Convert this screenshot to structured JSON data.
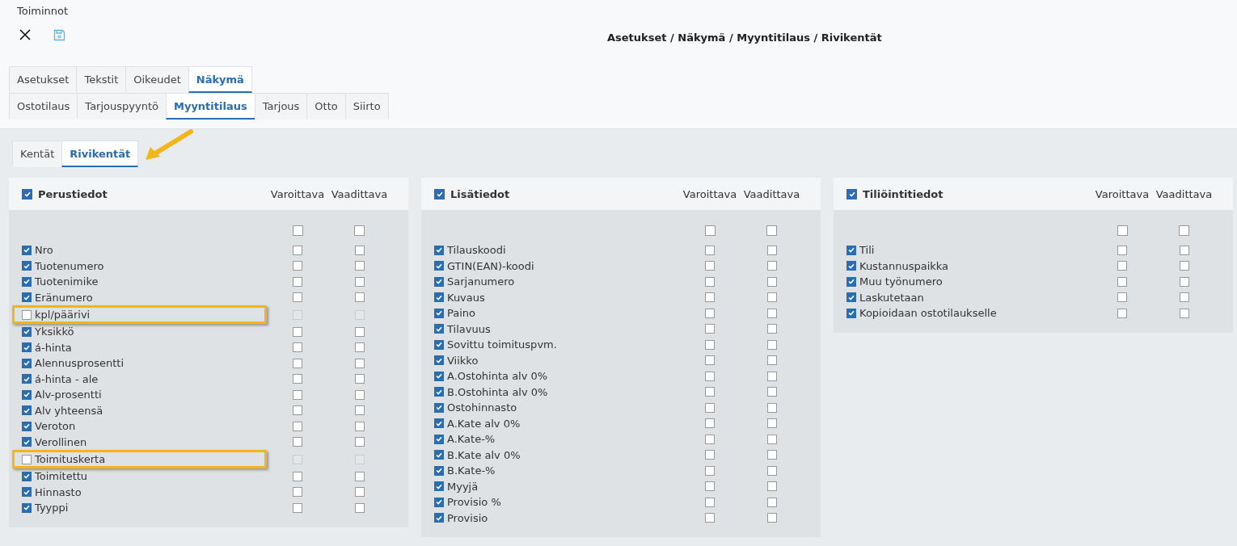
{
  "toolbar": {
    "title": "Toiminnot",
    "breadcrumb": "Asetukset / Näkymä / Myyntitilaus / Rivikentät"
  },
  "tabs": [
    {
      "label": "Asetukset",
      "selected": false
    },
    {
      "label": "Tekstit",
      "selected": false
    },
    {
      "label": "Oikeudet",
      "selected": false
    },
    {
      "label": "Näkymä",
      "selected": true
    }
  ],
  "subtabs": [
    {
      "label": "Ostotilaus",
      "selected": false
    },
    {
      "label": "Tarjouspyyntö",
      "selected": false
    },
    {
      "label": "Myyntitilaus",
      "selected": true
    },
    {
      "label": "Tarjous",
      "selected": false
    },
    {
      "label": "Otto",
      "selected": false
    },
    {
      "label": "Siirto",
      "selected": false
    }
  ],
  "section_tabs": [
    {
      "label": "Kentät",
      "selected": false
    },
    {
      "label": "Rivikentät",
      "selected": true
    }
  ],
  "panels": [
    {
      "title": "Perustiedot",
      "checked": true,
      "columns": [
        "Varoittava",
        "Vaadittava"
      ],
      "all_warning": false,
      "all_required": false,
      "fields": [
        {
          "label": "Nro",
          "checked": true,
          "warning": false,
          "required": false,
          "highlighted": false
        },
        {
          "label": "Tuotenumero",
          "checked": true,
          "warning": false,
          "required": false,
          "highlighted": false
        },
        {
          "label": "Tuotenimike",
          "checked": true,
          "warning": false,
          "required": false,
          "highlighted": false
        },
        {
          "label": "Eränumero",
          "checked": true,
          "warning": false,
          "required": false,
          "highlighted": false
        },
        {
          "label": "kpl/päärivi",
          "checked": false,
          "warning": false,
          "required": false,
          "highlighted": true
        },
        {
          "label": "Yksikkö",
          "checked": true,
          "warning": false,
          "required": false,
          "highlighted": false
        },
        {
          "label": "á-hinta",
          "checked": true,
          "warning": false,
          "required": false,
          "highlighted": false
        },
        {
          "label": "Alennusprosentti",
          "checked": true,
          "warning": false,
          "required": false,
          "highlighted": false
        },
        {
          "label": "á-hinta - ale",
          "checked": true,
          "warning": false,
          "required": false,
          "highlighted": false
        },
        {
          "label": "Alv-prosentti",
          "checked": true,
          "warning": false,
          "required": false,
          "highlighted": false
        },
        {
          "label": "Alv yhteensä",
          "checked": true,
          "warning": false,
          "required": false,
          "highlighted": false
        },
        {
          "label": "Veroton",
          "checked": true,
          "warning": false,
          "required": false,
          "highlighted": false
        },
        {
          "label": "Verollinen",
          "checked": true,
          "warning": false,
          "required": false,
          "highlighted": false
        },
        {
          "label": "Toimituskerta",
          "checked": false,
          "warning": false,
          "required": false,
          "highlighted": true
        },
        {
          "label": "Toimitettu",
          "checked": true,
          "warning": false,
          "required": false,
          "highlighted": false
        },
        {
          "label": "Hinnasto",
          "checked": true,
          "warning": false,
          "required": false,
          "highlighted": false
        },
        {
          "label": "Tyyppi",
          "checked": true,
          "warning": false,
          "required": false,
          "highlighted": false
        }
      ]
    },
    {
      "title": "Lisätiedot",
      "checked": true,
      "columns": [
        "Varoittava",
        "Vaadittava"
      ],
      "all_warning": false,
      "all_required": false,
      "fields": [
        {
          "label": "Tilauskoodi",
          "checked": true,
          "warning": false,
          "required": false,
          "highlighted": false
        },
        {
          "label": "GTIN(EAN)-koodi",
          "checked": true,
          "warning": false,
          "required": false,
          "highlighted": false
        },
        {
          "label": "Sarjanumero",
          "checked": true,
          "warning": false,
          "required": false,
          "highlighted": false
        },
        {
          "label": "Kuvaus",
          "checked": true,
          "warning": false,
          "required": false,
          "highlighted": false
        },
        {
          "label": "Paino",
          "checked": true,
          "warning": false,
          "required": false,
          "highlighted": false
        },
        {
          "label": "Tilavuus",
          "checked": true,
          "warning": false,
          "required": false,
          "highlighted": false
        },
        {
          "label": "Sovittu toimituspvm.",
          "checked": true,
          "warning": false,
          "required": false,
          "highlighted": false
        },
        {
          "label": "Viikko",
          "checked": true,
          "warning": false,
          "required": false,
          "highlighted": false
        },
        {
          "label": "A.Ostohinta alv 0%",
          "checked": true,
          "warning": false,
          "required": false,
          "highlighted": false
        },
        {
          "label": "B.Ostohinta alv 0%",
          "checked": true,
          "warning": false,
          "required": false,
          "highlighted": false
        },
        {
          "label": "Ostohinnasto",
          "checked": true,
          "warning": false,
          "required": false,
          "highlighted": false
        },
        {
          "label": "A.Kate alv 0%",
          "checked": true,
          "warning": false,
          "required": false,
          "highlighted": false
        },
        {
          "label": "A.Kate-%",
          "checked": true,
          "warning": false,
          "required": false,
          "highlighted": false
        },
        {
          "label": "B.Kate alv 0%",
          "checked": true,
          "warning": false,
          "required": false,
          "highlighted": false
        },
        {
          "label": "B.Kate-%",
          "checked": true,
          "warning": false,
          "required": false,
          "highlighted": false
        },
        {
          "label": "Myyjä",
          "checked": true,
          "warning": false,
          "required": false,
          "highlighted": false
        },
        {
          "label": "Provisio %",
          "checked": true,
          "warning": false,
          "required": false,
          "highlighted": false
        },
        {
          "label": "Provisio",
          "checked": true,
          "warning": false,
          "required": false,
          "highlighted": false
        }
      ]
    },
    {
      "title": "Tiliöintitiedot",
      "checked": true,
      "columns": [
        "Varoittava",
        "Vaadittava"
      ],
      "all_warning": false,
      "all_required": false,
      "fields": [
        {
          "label": "Tili",
          "checked": true,
          "warning": false,
          "required": false,
          "highlighted": false
        },
        {
          "label": "Kustannuspaikka",
          "checked": true,
          "warning": false,
          "required": false,
          "highlighted": false
        },
        {
          "label": "Muu työnumero",
          "checked": true,
          "warning": false,
          "required": false,
          "highlighted": false
        },
        {
          "label": "Laskutetaan",
          "checked": true,
          "warning": false,
          "required": false,
          "highlighted": false
        },
        {
          "label": "Kopioidaan ostotilaukselle",
          "checked": true,
          "warning": false,
          "required": false,
          "highlighted": false
        }
      ]
    }
  ]
}
